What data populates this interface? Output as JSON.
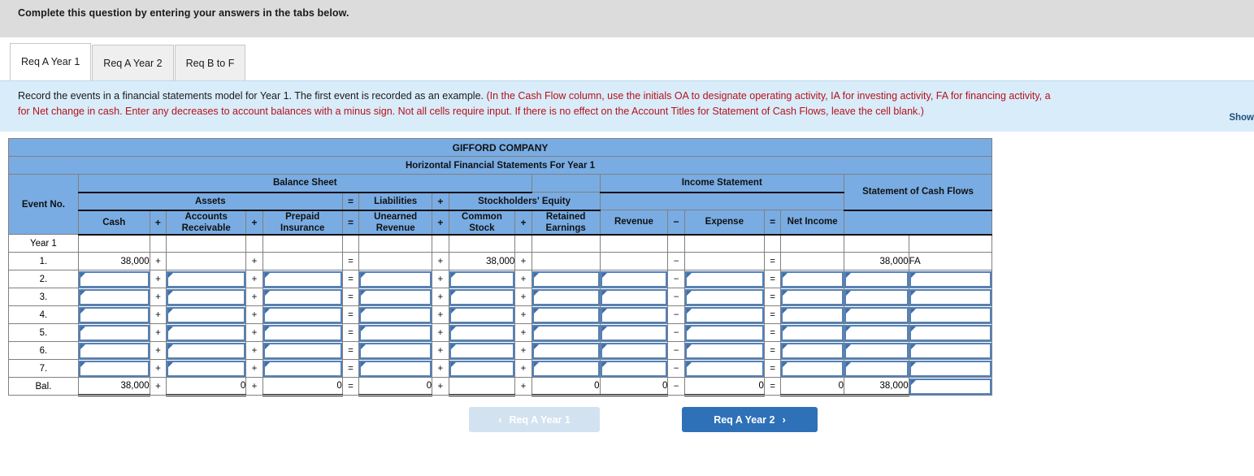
{
  "banner": {
    "text": "Complete this question by entering your answers in the tabs below."
  },
  "tabs": [
    {
      "label": "Req A Year 1",
      "active": true
    },
    {
      "label": "Req A Year 2",
      "active": false
    },
    {
      "label": "Req B to F",
      "active": false
    }
  ],
  "instruction": {
    "line1_black": "Record the events in a financial statements model for Year 1. The first event is recorded as an example. ",
    "line1_red": "(In the Cash Flow column, use the initials OA to designate operating activity, IA for investing activity, FA for financing activity, a",
    "line2_red": "for Net change in cash. Enter any decreases to account balances with a minus sign. Not all cells require input. If there is no effect on the Account Titles for Statement of Cash Flows, leave the cell blank.)",
    "show_link": "Show"
  },
  "table": {
    "company": "GIFFORD COMPANY",
    "subtitle": "Horizontal Financial Statements For Year 1",
    "groups": {
      "event_no": "Event No.",
      "balance_sheet": "Balance Sheet",
      "income_statement": "Income Statement",
      "cash_flows": "Statement of Cash Flows",
      "assets": "Assets",
      "liabilities": "Liabilities",
      "equity": "Stockholders' Equity"
    },
    "columns": {
      "cash": "Cash",
      "accounts_receivable": "Accounts Receivable",
      "prepaid_insurance": "Prepaid Insurance",
      "unearned_revenue": "Unearned Revenue",
      "common_stock": "Common Stock",
      "retained_earnings": "Retained Earnings",
      "revenue": "Revenue",
      "expense": "Expense",
      "net_income": "Net Income"
    },
    "operators": {
      "plus": "+",
      "equals": "=",
      "minus": "−"
    },
    "rows": {
      "year_label": "Year 1",
      "event_1": "1.",
      "event_2": "2.",
      "event_3": "3.",
      "event_4": "4.",
      "event_5": "5.",
      "event_6": "6.",
      "event_7": "7.",
      "balance": "Bal."
    },
    "example_row": {
      "cash": "38,000",
      "accounts_receivable": "",
      "prepaid_insurance": "",
      "unearned_revenue": "",
      "common_stock": "38,000",
      "retained_earnings": "",
      "revenue": "",
      "expense": "",
      "net_income": "",
      "cash_flow_amount": "38,000",
      "cash_flow_activity": "FA"
    },
    "balance_row": {
      "cash": "38,000",
      "accounts_receivable": "0",
      "prepaid_insurance": "0",
      "unearned_revenue": "0",
      "common_stock": "",
      "retained_earnings": "0",
      "revenue": "0",
      "expense": "0",
      "net_income": "0",
      "cash_flow_amount": "38,000",
      "cash_flow_activity": ""
    }
  },
  "footer": {
    "prev_label": "Req A Year 1",
    "next_label": "Req A Year 2",
    "prev_chevron": "‹",
    "next_chevron": "›"
  },
  "colors": {
    "header_blue": "#79ace3",
    "panel_blue": "#d9ecfa",
    "instruction_red": "#b5121b",
    "primary_button": "#2e71b8",
    "disabled_button": "#d3e2f0",
    "input_border": "#4f81bd"
  }
}
